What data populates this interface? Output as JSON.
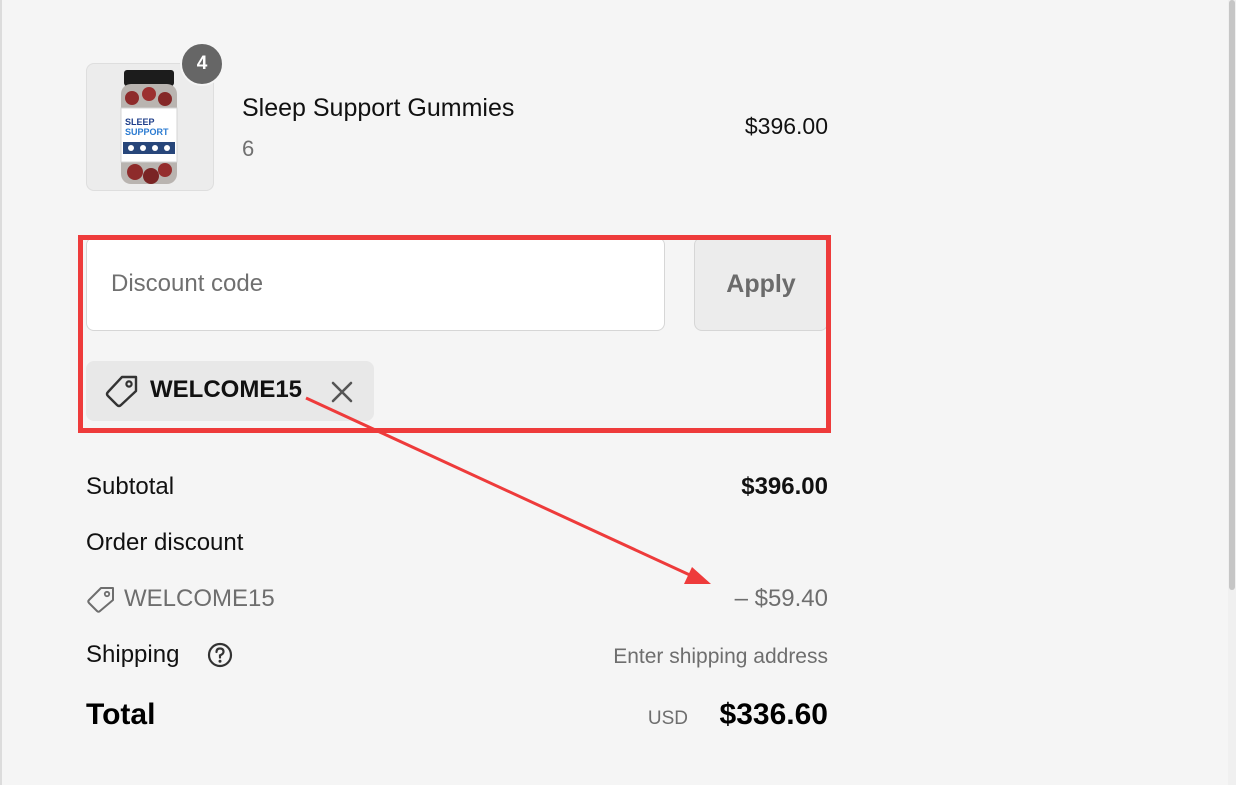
{
  "colors": {
    "accent_annotation": "#ee3b3b",
    "badge_bg": "#666666",
    "muted_text": "#6e6e6e"
  },
  "cart": {
    "item": {
      "quantity": "4",
      "name": "Sleep Support Gummies",
      "variant": "6",
      "price": "$396.00",
      "image_icon": "gummies-bottle-image"
    }
  },
  "discount": {
    "placeholder": "Discount code",
    "apply_label": "Apply",
    "applied_code": "WELCOME15",
    "tag_icon": "tag-icon",
    "remove_icon": "close-icon"
  },
  "summary": {
    "subtotal_label": "Subtotal",
    "subtotal_value": "$396.00",
    "order_discount_label": "Order discount",
    "discount_code": "WELCOME15",
    "discount_amount": "– $59.40",
    "shipping_label": "Shipping",
    "shipping_value": "Enter shipping address",
    "total_label": "Total",
    "total_currency": "USD",
    "total_value": "$336.60"
  }
}
